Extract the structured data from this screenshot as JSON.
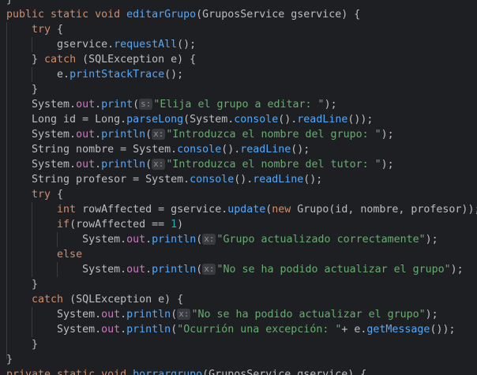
{
  "editor": {
    "lines": [
      [
        {
          "t": "}",
          "c": "p"
        }
      ],
      [
        {
          "t": "public static void ",
          "c": "kw"
        },
        {
          "t": "editarGrupo",
          "c": "fn"
        },
        {
          "t": "(GruposService gservice) {",
          "c": "p"
        }
      ],
      [
        {
          "t": "    try ",
          "c": "kw"
        },
        {
          "t": "{",
          "c": "p"
        }
      ],
      [
        {
          "t": "        gservice.",
          "c": "p"
        },
        {
          "t": "requestAll",
          "c": "fn"
        },
        {
          "t": "();",
          "c": "p"
        }
      ],
      [
        {
          "t": "    } ",
          "c": "p"
        },
        {
          "t": "catch ",
          "c": "kw"
        },
        {
          "t": "(SQLException e) {",
          "c": "p"
        }
      ],
      [
        {
          "t": "        e.",
          "c": "p"
        },
        {
          "t": "printStackTrace",
          "c": "fn"
        },
        {
          "t": "();",
          "c": "p"
        }
      ],
      [
        {
          "t": "    }",
          "c": "p"
        }
      ],
      [
        {
          "t": "    System.",
          "c": "p"
        },
        {
          "t": "out",
          "c": "fld"
        },
        {
          "t": ".",
          "c": "p"
        },
        {
          "t": "print",
          "c": "fn"
        },
        {
          "t": "(",
          "c": "p"
        },
        {
          "t": "s:",
          "c": "hint"
        },
        {
          "t": "\"Elija el grupo a editar: \"",
          "c": "str"
        },
        {
          "t": ");",
          "c": "p"
        }
      ],
      [
        {
          "t": "    Long id = Long.",
          "c": "p"
        },
        {
          "t": "parseLong",
          "c": "fn"
        },
        {
          "t": "(System.",
          "c": "p"
        },
        {
          "t": "console",
          "c": "fn"
        },
        {
          "t": "().",
          "c": "p"
        },
        {
          "t": "readLine",
          "c": "fn"
        },
        {
          "t": "());",
          "c": "p"
        }
      ],
      [
        {
          "t": "    System.",
          "c": "p"
        },
        {
          "t": "out",
          "c": "fld"
        },
        {
          "t": ".",
          "c": "p"
        },
        {
          "t": "println",
          "c": "fn"
        },
        {
          "t": "(",
          "c": "p"
        },
        {
          "t": "x:",
          "c": "hint"
        },
        {
          "t": "\"Introduzca el nombre del grupo: \"",
          "c": "str"
        },
        {
          "t": ");",
          "c": "p"
        }
      ],
      [
        {
          "t": "    String nombre = System.",
          "c": "p"
        },
        {
          "t": "console",
          "c": "fn"
        },
        {
          "t": "().",
          "c": "p"
        },
        {
          "t": "readLine",
          "c": "fn"
        },
        {
          "t": "();",
          "c": "p"
        }
      ],
      [
        {
          "t": "    System.",
          "c": "p"
        },
        {
          "t": "out",
          "c": "fld"
        },
        {
          "t": ".",
          "c": "p"
        },
        {
          "t": "println",
          "c": "fn"
        },
        {
          "t": "(",
          "c": "p"
        },
        {
          "t": "x:",
          "c": "hint"
        },
        {
          "t": "\"Introduzca el nombre del tutor: \"",
          "c": "str"
        },
        {
          "t": ");",
          "c": "p"
        }
      ],
      [
        {
          "t": "    String profesor = System.",
          "c": "p"
        },
        {
          "t": "console",
          "c": "fn"
        },
        {
          "t": "().",
          "c": "p"
        },
        {
          "t": "readLine",
          "c": "fn"
        },
        {
          "t": "();",
          "c": "p"
        }
      ],
      [
        {
          "t": "    try ",
          "c": "kw"
        },
        {
          "t": "{",
          "c": "p"
        }
      ],
      [
        {
          "t": "        ",
          "c": "p"
        },
        {
          "t": "int ",
          "c": "kw"
        },
        {
          "t": "rowAffected = gservice.",
          "c": "p"
        },
        {
          "t": "update",
          "c": "fn"
        },
        {
          "t": "(",
          "c": "p"
        },
        {
          "t": "new ",
          "c": "kw"
        },
        {
          "t": "Grupo(id, nombre, profesor));",
          "c": "p"
        }
      ],
      [
        {
          "t": "        ",
          "c": "p"
        },
        {
          "t": "if",
          "c": "kw"
        },
        {
          "t": "(rowAffected == ",
          "c": "p"
        },
        {
          "t": "1",
          "c": "num"
        },
        {
          "t": ")",
          "c": "p"
        }
      ],
      [
        {
          "t": "            System.",
          "c": "p"
        },
        {
          "t": "out",
          "c": "fld"
        },
        {
          "t": ".",
          "c": "p"
        },
        {
          "t": "println",
          "c": "fn"
        },
        {
          "t": "(",
          "c": "p"
        },
        {
          "t": "x:",
          "c": "hint"
        },
        {
          "t": "\"Grupo actualizado correctamente\"",
          "c": "str"
        },
        {
          "t": ");",
          "c": "p"
        }
      ],
      [
        {
          "t": "        ",
          "c": "p"
        },
        {
          "t": "else",
          "c": "kw"
        }
      ],
      [
        {
          "t": "            System.",
          "c": "p"
        },
        {
          "t": "out",
          "c": "fld"
        },
        {
          "t": ".",
          "c": "p"
        },
        {
          "t": "println",
          "c": "fn"
        },
        {
          "t": "(",
          "c": "p"
        },
        {
          "t": "x:",
          "c": "hint"
        },
        {
          "t": "\"No se ha podido actualizar el grupo\"",
          "c": "str"
        },
        {
          "t": ");",
          "c": "p"
        }
      ],
      [
        {
          "t": "    }",
          "c": "p"
        }
      ],
      [
        {
          "t": "    ",
          "c": "p"
        },
        {
          "t": "catch ",
          "c": "kw"
        },
        {
          "t": "(SQLException e) {",
          "c": "p"
        }
      ],
      [
        {
          "t": "        System.",
          "c": "p"
        },
        {
          "t": "out",
          "c": "fld"
        },
        {
          "t": ".",
          "c": "p"
        },
        {
          "t": "println",
          "c": "fn"
        },
        {
          "t": "(",
          "c": "p"
        },
        {
          "t": "x:",
          "c": "hint"
        },
        {
          "t": "\"No se ha podido actualizar el grupo\"",
          "c": "str"
        },
        {
          "t": ");",
          "c": "p"
        }
      ],
      [
        {
          "t": "        System.",
          "c": "p"
        },
        {
          "t": "out",
          "c": "fld"
        },
        {
          "t": ".",
          "c": "p"
        },
        {
          "t": "println",
          "c": "fn"
        },
        {
          "t": "(",
          "c": "p"
        },
        {
          "t": "\"Ocurrión una excepción: \"",
          "c": "str"
        },
        {
          "t": "+ e.",
          "c": "p"
        },
        {
          "t": "getMessage",
          "c": "fn"
        },
        {
          "t": "());",
          "c": "p"
        }
      ],
      [
        {
          "t": "    }",
          "c": "p"
        }
      ],
      [
        {
          "t": "}",
          "c": "p"
        }
      ],
      [
        {
          "t": "private static void ",
          "c": "kw"
        },
        {
          "t": "borrargrupo",
          "c": "fn"
        },
        {
          "t": "(GruposService gservice) {",
          "c": "p"
        }
      ]
    ]
  },
  "colors": {
    "background": "#1e1f22",
    "plain": "#bcbec4",
    "keyword": "#cf8e6d",
    "method": "#56a8f5",
    "string": "#6aab73",
    "field": "#c77dbb",
    "number": "#2aacb8"
  }
}
